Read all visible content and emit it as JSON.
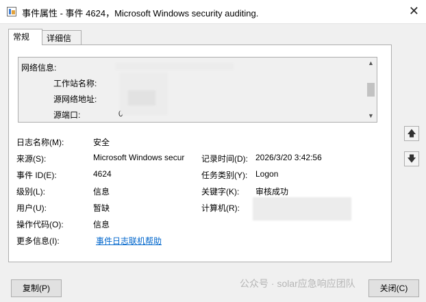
{
  "window": {
    "title": "事件属性 - 事件 4624，Microsoft Windows security auditing.",
    "close_glyph": "✕"
  },
  "tabs": [
    {
      "label": "常规",
      "active": true
    },
    {
      "label": "详细信息",
      "active": false
    }
  ],
  "description": {
    "network_header": "网络信息:",
    "workstation_label": "工作站名称:",
    "source_address_label": "源网络地址:",
    "source_port_label": "源端口:",
    "source_port_value": "0"
  },
  "fields": {
    "log_name_label": "日志名称(M):",
    "log_name_value": "安全",
    "source_label": "来源(S):",
    "source_value": "Microsoft Windows secur",
    "logged_label": "记录时间(D):",
    "logged_value": "2026/3/20 3:42:56",
    "event_id_label": "事件 ID(E):",
    "event_id_value": "4624",
    "task_category_label": "任务类别(Y):",
    "task_category_value": "Logon",
    "level_label": "级别(L):",
    "level_value": "信息",
    "keywords_label": "关键字(K):",
    "keywords_value": "审核成功",
    "user_label": "用户(U):",
    "user_value": "暂缺",
    "computer_label": "计算机(R):",
    "opcode_label": "操作代码(O):",
    "opcode_value": "信息",
    "more_info_label": "更多信息(I):",
    "more_info_link": "事件日志联机帮助"
  },
  "buttons": {
    "copy": "复制(P)",
    "close": "关闭(C)",
    "up_glyph": "🡅",
    "down_glyph": "🡇"
  },
  "watermark": "公众号 · solar应急响应团队"
}
